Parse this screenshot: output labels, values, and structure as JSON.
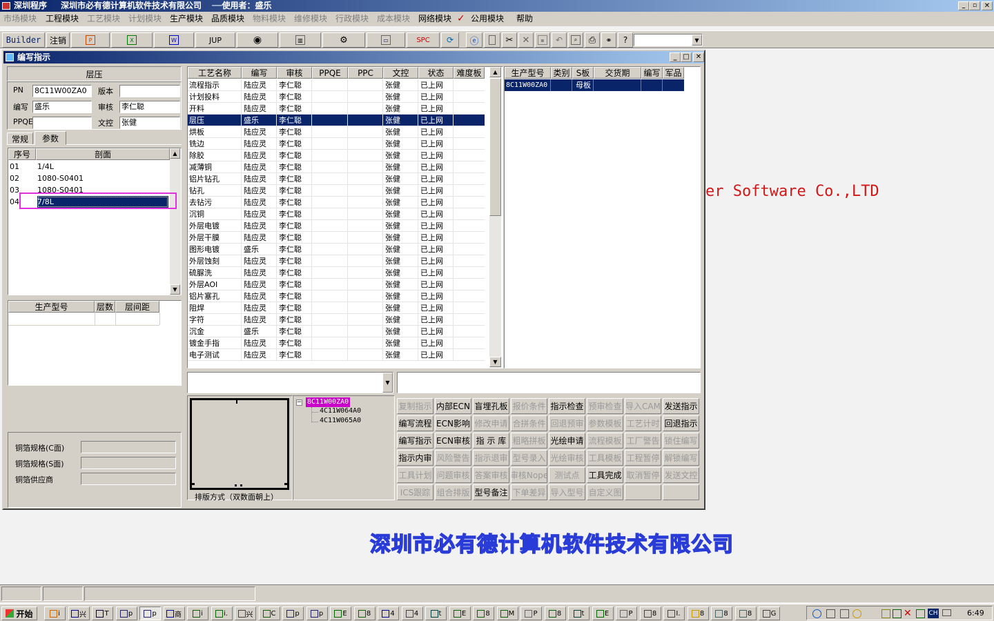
{
  "app": {
    "title": "深圳程序",
    "company": "深圳市必有德计算机软件技术有限公司",
    "user_line": "──使用者：盛乐",
    "bg_en": "er Software Co.,LTD",
    "bg_cn": "深圳市必有德计算机软件技术有限公司"
  },
  "menu": [
    {
      "label": "市场模块",
      "dis": true
    },
    {
      "label": "工程模块",
      "dis": false
    },
    {
      "label": "工艺模块",
      "dis": true
    },
    {
      "label": "计划模块",
      "dis": true
    },
    {
      "label": "生产模块",
      "dis": false
    },
    {
      "label": "品质模块",
      "dis": false
    },
    {
      "label": "物料模块",
      "dis": true
    },
    {
      "label": "维修模块",
      "dis": true
    },
    {
      "label": "行政模块",
      "dis": true
    },
    {
      "label": "成本模块",
      "dis": true
    },
    {
      "label": "网络模块",
      "dis": false
    },
    {
      "label": "公用模块",
      "dis": false
    },
    {
      "label": "帮助",
      "dis": false
    }
  ],
  "toolbar": {
    "builder": "Builder",
    "logout": "注销",
    "jup": "JUP",
    "spc": "SPC",
    "items": [
      "Builder",
      "注销",
      "ppt-icon",
      "excel-icon",
      "word-icon",
      "JUP",
      "eye-icon",
      "trash-icon",
      "network-icon",
      "computer-icon",
      "SPC",
      "refresh-icon",
      "ie-icon",
      "new-icon",
      "cut-icon",
      "delete-icon",
      "save-icon",
      "undo-icon",
      "preview-icon",
      "print-icon",
      "find-icon",
      "help-icon"
    ]
  },
  "window": {
    "title": "编写指示"
  },
  "left": {
    "section_title": "层压",
    "pn_label": "PN",
    "pn_value": "8C11W00ZA0",
    "version_label": "版本",
    "version_value": "",
    "writer_label": "编写",
    "writer_value": "盛乐",
    "review_label": "审核",
    "review_value": "李仁聪",
    "ppqe_label": "PPQE",
    "ppqe_value": "",
    "doc_label": "文控",
    "doc_value": "张健",
    "tab_normal": "常规",
    "tab_params": "参数",
    "seq_header": "序号",
    "section_header": "剖面",
    "sections": [
      {
        "seq": "01",
        "name": "1/4L"
      },
      {
        "seq": "02",
        "name": "1080-S0401"
      },
      {
        "seq": "03",
        "name": "1080-S0401"
      },
      {
        "seq": "04",
        "name": "7/8L"
      }
    ],
    "model_col": "生产型号",
    "layers_col": "层数",
    "spacing_col": "层间距",
    "copper_c": "铜箔规格(C面)",
    "copper_s": "铜箔规格(S面)",
    "copper_supplier": "铜箔供应商"
  },
  "process": {
    "headers": [
      "工艺名称",
      "编写",
      "审核",
      "PPQE",
      "PPC",
      "文控",
      "状态",
      "难度板"
    ],
    "rows": [
      [
        "流程指示",
        "陆应灵",
        "李仁聪",
        "",
        "",
        "张健",
        "已上网",
        ""
      ],
      [
        "计划投料",
        "陆应灵",
        "李仁聪",
        "",
        "",
        "张健",
        "已上网",
        ""
      ],
      [
        "开料",
        "陆应灵",
        "李仁聪",
        "",
        "",
        "张健",
        "已上网",
        ""
      ],
      [
        "层压",
        "盛乐",
        "李仁聪",
        "",
        "",
        "张健",
        "已上网",
        ""
      ],
      [
        "烘板",
        "陆应灵",
        "李仁聪",
        "",
        "",
        "张健",
        "已上网",
        ""
      ],
      [
        "铣边",
        "陆应灵",
        "李仁聪",
        "",
        "",
        "张健",
        "已上网",
        ""
      ],
      [
        "除胶",
        "陆应灵",
        "李仁聪",
        "",
        "",
        "张健",
        "已上网",
        ""
      ],
      [
        "减薄铜",
        "陆应灵",
        "李仁聪",
        "",
        "",
        "张健",
        "已上网",
        ""
      ],
      [
        "铝片钻孔",
        "陆应灵",
        "李仁聪",
        "",
        "",
        "张健",
        "已上网",
        ""
      ],
      [
        "钻孔",
        "陆应灵",
        "李仁聪",
        "",
        "",
        "张健",
        "已上网",
        ""
      ],
      [
        "去钻污",
        "陆应灵",
        "李仁聪",
        "",
        "",
        "张健",
        "已上网",
        ""
      ],
      [
        "沉铜",
        "陆应灵",
        "李仁聪",
        "",
        "",
        "张健",
        "已上网",
        ""
      ],
      [
        "外层电镀",
        "陆应灵",
        "李仁聪",
        "",
        "",
        "张健",
        "已上网",
        ""
      ],
      [
        "外层干膜",
        "陆应灵",
        "李仁聪",
        "",
        "",
        "张健",
        "已上网",
        ""
      ],
      [
        "图形电镀",
        "盛乐",
        "李仁聪",
        "",
        "",
        "张健",
        "已上网",
        ""
      ],
      [
        "外层蚀刻",
        "陆应灵",
        "李仁聪",
        "",
        "",
        "张健",
        "已上网",
        ""
      ],
      [
        "硫脲洗",
        "陆应灵",
        "李仁聪",
        "",
        "",
        "张健",
        "已上网",
        ""
      ],
      [
        "外层AOI",
        "陆应灵",
        "李仁聪",
        "",
        "",
        "张健",
        "已上网",
        ""
      ],
      [
        "铝片塞孔",
        "陆应灵",
        "李仁聪",
        "",
        "",
        "张健",
        "已上网",
        ""
      ],
      [
        "阻焊",
        "陆应灵",
        "李仁聪",
        "",
        "",
        "张健",
        "已上网",
        ""
      ],
      [
        "字符",
        "陆应灵",
        "李仁聪",
        "",
        "",
        "张健",
        "已上网",
        ""
      ],
      [
        "沉金",
        "盛乐",
        "李仁聪",
        "",
        "",
        "张健",
        "已上网",
        ""
      ],
      [
        "镀金手指",
        "陆应灵",
        "李仁聪",
        "",
        "",
        "张健",
        "已上网",
        ""
      ],
      [
        "电子测试",
        "陆应灵",
        "李仁聪",
        "",
        "",
        "张健",
        "已上网",
        ""
      ]
    ]
  },
  "models": {
    "headers": [
      "生产型号",
      "类别",
      "S板",
      "交货期",
      "编写",
      "军品"
    ],
    "rows": [
      [
        "8C11W00ZA0",
        "",
        "母板",
        "",
        "",
        ""
      ]
    ]
  },
  "tree": {
    "root": "8C11W00ZA0",
    "children": [
      "4C11W064A0",
      "4C11W065A0"
    ]
  },
  "layout_label": "排版方式（双数面朝上）",
  "actions": [
    [
      {
        "t": "复制指示",
        "d": true
      },
      {
        "t": "内部ECN",
        "d": false
      },
      {
        "t": "盲埋孔板",
        "d": false
      },
      {
        "t": "报价条件",
        "d": true
      },
      {
        "t": "指示检查",
        "d": false
      },
      {
        "t": "预审检查",
        "d": true
      },
      {
        "t": "导入CAM",
        "d": true
      },
      {
        "t": "发送指示",
        "d": false
      }
    ],
    [
      {
        "t": "编写流程",
        "d": false
      },
      {
        "t": "ECN影响",
        "d": false
      },
      {
        "t": "修改申请",
        "d": true
      },
      {
        "t": "合拼条件",
        "d": true
      },
      {
        "t": "回退预审",
        "d": true
      },
      {
        "t": "参数模板",
        "d": true
      },
      {
        "t": "工艺计时",
        "d": true
      },
      {
        "t": "回退指示",
        "d": false
      }
    ],
    [
      {
        "t": "编写指示",
        "d": false
      },
      {
        "t": "ECN审核",
        "d": false
      },
      {
        "t": "指 示 库",
        "d": false
      },
      {
        "t": "粗略拼板",
        "d": true
      },
      {
        "t": "光绘申请",
        "d": false
      },
      {
        "t": "流程模板",
        "d": true
      },
      {
        "t": "工厂警告",
        "d": true
      },
      {
        "t": "锁住编写",
        "d": true
      }
    ],
    [
      {
        "t": "指示内审",
        "d": false
      },
      {
        "t": "风险警告",
        "d": true
      },
      {
        "t": "指示退审",
        "d": true
      },
      {
        "t": "型号录入",
        "d": true
      },
      {
        "t": "光绘审核",
        "d": true
      },
      {
        "t": "工具模板",
        "d": true
      },
      {
        "t": "工程暂停",
        "d": true
      },
      {
        "t": "解锁编写",
        "d": true
      }
    ],
    [
      {
        "t": "工具计划",
        "d": true
      },
      {
        "t": "问题审核",
        "d": true
      },
      {
        "t": "答案审核",
        "d": true
      },
      {
        "t": "审核Nope",
        "d": true
      },
      {
        "t": "测试点",
        "d": true
      },
      {
        "t": "工具完成",
        "d": false
      },
      {
        "t": "取消暂停",
        "d": true
      },
      {
        "t": "发送文控",
        "d": true
      }
    ],
    [
      {
        "t": "ICS跟踪",
        "d": true
      },
      {
        "t": "组合排版",
        "d": true
      },
      {
        "t": "型号备注",
        "d": false
      },
      {
        "t": "下单差异",
        "d": true
      },
      {
        "t": "导入型号",
        "d": true
      },
      {
        "t": "自定义图",
        "d": true
      },
      {
        "t": "",
        "d": true
      },
      {
        "t": "",
        "d": true
      }
    ]
  ],
  "taskbar": {
    "start": "开始",
    "clock": "6:49",
    "ime": "CH",
    "tasks": [
      "i",
      "兴",
      "T",
      "p",
      "p",
      "商",
      "i",
      "i.",
      "兴",
      "C",
      "p",
      "p",
      "E",
      "8",
      "4",
      "4",
      "t",
      "E",
      "8",
      "M",
      "P",
      "8",
      "t",
      "E",
      "P",
      "8",
      "I.",
      "8",
      "8",
      "8",
      "G"
    ]
  }
}
